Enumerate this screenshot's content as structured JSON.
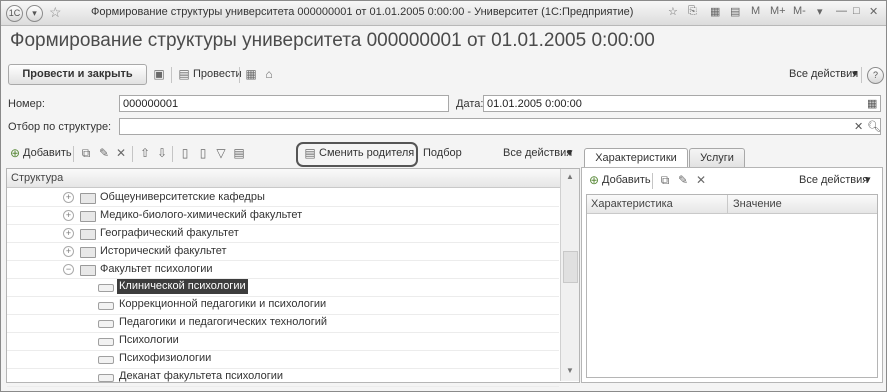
{
  "window": {
    "title": "Формирование структуры университета 000000001 от 01.01.2005 0:00:00 - Университет (1С:Предприятие)",
    "controls": [
      "M",
      "M+",
      "M-"
    ]
  },
  "form": {
    "caption": "Формирование структуры университета 000000001 от 01.01.2005 0:00:00"
  },
  "toolbar": {
    "post_close_label": "Провести и закрыть",
    "post_label": "Провести",
    "all_actions_label": "Все действия",
    "help_label": "?"
  },
  "fields": {
    "number_label": "Номер:",
    "number_value": "000000001",
    "date_label": "Дата:",
    "date_value": "01.01.2005  0:00:00",
    "filter_label": "Отбор по структуре:",
    "filter_value": ""
  },
  "structure_toolbar": {
    "add_label": "Добавить",
    "change_parent_label": "Сменить родителя",
    "selection_label": "Подбор",
    "all_actions_label": "Все действия"
  },
  "structure_grid": {
    "column_header": "Структура",
    "rows": [
      {
        "label": "Общеуниверситетские кафедры",
        "kind": "folder",
        "expander": "+"
      },
      {
        "label": "Медико-биолого-химический факультет",
        "kind": "folder",
        "expander": "+"
      },
      {
        "label": "Географический факультет",
        "kind": "folder",
        "expander": "+"
      },
      {
        "label": "Исторический факультет",
        "kind": "folder",
        "expander": "+"
      },
      {
        "label": "Факультет психологии",
        "kind": "folder",
        "expander": "−"
      },
      {
        "label": "Клинической психологии",
        "kind": "item",
        "selected": true
      },
      {
        "label": "Коррекционной педагогики и психологии",
        "kind": "item"
      },
      {
        "label": "Педагогики и педагогических технологий",
        "kind": "item"
      },
      {
        "label": "Психологии",
        "kind": "item"
      },
      {
        "label": "Психофизиологии",
        "kind": "item"
      },
      {
        "label": "Деканат факультета психологии",
        "kind": "item"
      }
    ]
  },
  "right_panel": {
    "tabs": [
      "Характеристики",
      "Услуги"
    ],
    "add_label": "Добавить",
    "all_actions_label": "Все действия",
    "columns": [
      "Характеристика",
      "Значение"
    ]
  },
  "colors": {
    "selection": "#3d3d3d",
    "highlight_border": "#555555"
  }
}
